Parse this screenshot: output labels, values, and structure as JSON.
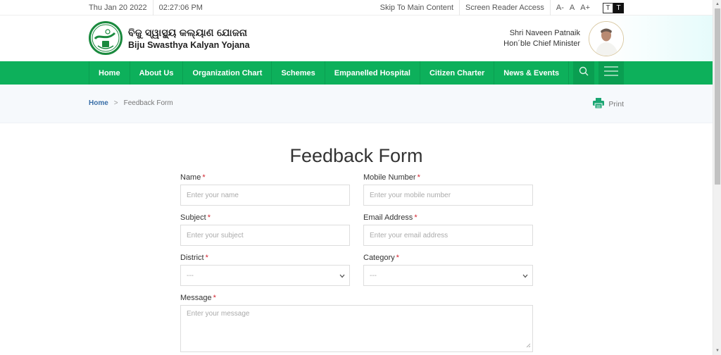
{
  "topbar": {
    "date": "Thu Jan 20 2022",
    "time": "02:27:06 PM",
    "skip_link": "Skip To Main Content",
    "screen_reader": "Screen Reader Access",
    "font_decrease": "A-",
    "font_normal": "A",
    "font_increase": "A+",
    "theme_light": "T",
    "theme_dark": "T"
  },
  "header": {
    "title_odia": "ବିଜୁ ସ୍ୱାସ୍ଥ୍ୟ କଲ୍ୟାଣ ଯୋଜନା",
    "title_english": "Biju Swasthya Kalyan Yojana",
    "cm_name": "Shri Naveen Patnaik",
    "cm_title": "Hon´ble Chief Minister"
  },
  "nav": {
    "items": [
      {
        "label": "Home"
      },
      {
        "label": "About Us"
      },
      {
        "label": "Organization Chart"
      },
      {
        "label": "Schemes"
      },
      {
        "label": "Empanelled Hospital"
      },
      {
        "label": "Citizen Charter"
      },
      {
        "label": "News & Events"
      }
    ],
    "search_icon": "search-icon",
    "menu_icon": "hamburger-menu-icon",
    "accent": "#0db05b"
  },
  "breadcrumb": {
    "home": "Home",
    "separator": ">",
    "current": "Feedback Form",
    "print_label": "Print"
  },
  "form": {
    "title": "Feedback Form",
    "required_marker": "*",
    "fields": {
      "name": {
        "label": "Name",
        "placeholder": "Enter your name",
        "value": ""
      },
      "mobile": {
        "label": "Mobile Number",
        "placeholder": "Enter your mobile number",
        "value": ""
      },
      "subject": {
        "label": "Subject",
        "placeholder": "Enter your subject",
        "value": ""
      },
      "email": {
        "label": "Email Address",
        "placeholder": "Enter your email address",
        "value": ""
      },
      "district": {
        "label": "District",
        "selected": "---"
      },
      "category": {
        "label": "Category",
        "selected": "---"
      },
      "message": {
        "label": "Message",
        "placeholder": "Enter your message",
        "value": ""
      }
    }
  }
}
